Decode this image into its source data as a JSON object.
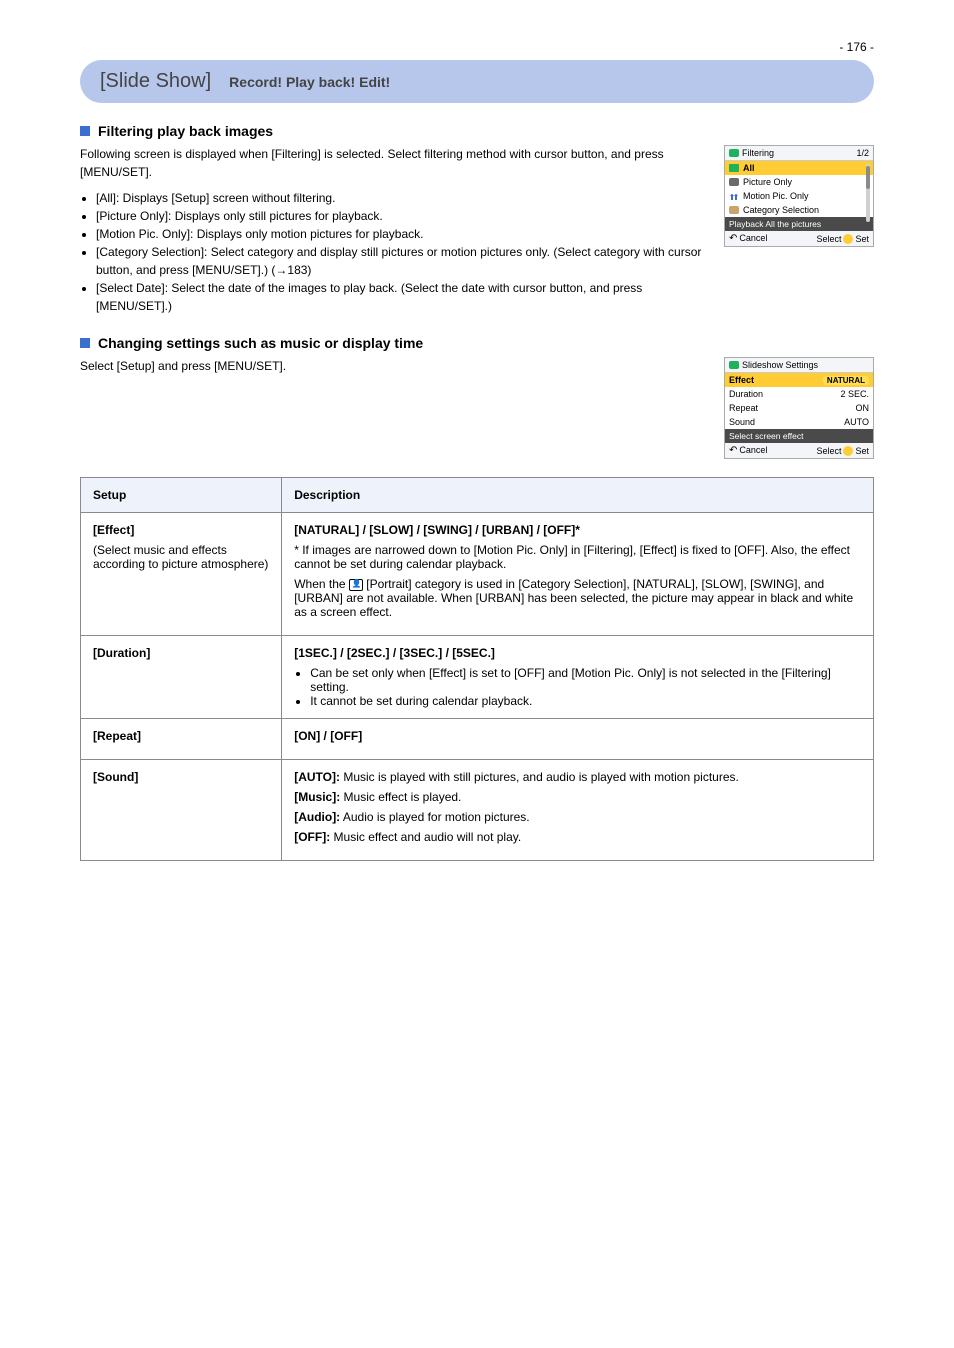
{
  "page_number": "- 176 -",
  "header": {
    "title": "[Slide Show]",
    "slogan": "Record! Play back! Edit!"
  },
  "filtering": {
    "subhead": "Filtering play back images",
    "intro": "Following screen is displayed when [Filtering] is selected. Select filtering method with cursor button, and press [MENU/SET].",
    "bullets": [
      "[All]: Displays [Setup] screen without filtering.",
      "[Picture Only]: Displays only still pictures for playback.",
      "[Motion Pic. Only]: Displays only motion pictures for playback.",
      "[Category Selection]: Select category and display still pictures or motion pictures only. (Select category with cursor button, and press [MENU/SET].) (→183)",
      "[Select Date]: Select the date of the images to play back. (Select the date with cursor button, and press [MENU/SET].)"
    ],
    "screenshot": {
      "title": "Filtering",
      "page": "1/2",
      "items": [
        {
          "label": "All",
          "icon": "green",
          "selected": true
        },
        {
          "label": "Picture Only",
          "icon": "gray"
        },
        {
          "label": "Motion Pic. Only",
          "icon": "blueppl"
        },
        {
          "label": "Category Selection",
          "icon": "tag"
        }
      ],
      "strip": "Playback All the pictures",
      "cancel": "Cancel",
      "select": "Select",
      "set": "Set"
    }
  },
  "settings": {
    "subhead": "Changing settings such as music or display time",
    "intro": "Select [Setup] and press [MENU/SET].",
    "screenshot": {
      "title": "Slideshow Settings",
      "rows": [
        {
          "label": "Effect",
          "value": "NATURAL",
          "selected": true
        },
        {
          "label": "Duration",
          "value": "2 SEC."
        },
        {
          "label": "Repeat",
          "value": "ON"
        },
        {
          "label": "Sound",
          "value": "AUTO"
        }
      ],
      "strip": "Select screen effect",
      "cancel": "Cancel",
      "select": "Select",
      "set": "Set"
    }
  },
  "table": {
    "head": {
      "c1": "Setup",
      "c2": "Description"
    },
    "rows": [
      {
        "name": "[Effect]",
        "name_note": "(Select music and effects according to picture atmosphere)",
        "desc_lead": "[NATURAL] / [SLOW] / [SWING] / [URBAN] / [OFF]*",
        "desc_para1": "* If images are narrowed down to [Motion Pic. Only] in [Filtering], [Effect] is fixed to [OFF]. Also, the effect cannot be set during calendar playback.",
        "desc_para2_pre": "When the ",
        "desc_para2_post": " [Portrait] category is used in [Category Selection], [NATURAL], [SLOW], [SWING], and [URBAN] are not available. When [URBAN] has been selected, the picture may appear in black and white as a screen effect."
      },
      {
        "name": "[Duration]",
        "desc_lead": "[1SEC.] / [2SEC.] / [3SEC.] / [5SEC.]",
        "bullets": [
          "Can be set only when [Effect] is set to [OFF] and [Motion Pic. Only] is not selected in the [Filtering] setting.",
          "It cannot be set during calendar playback."
        ]
      },
      {
        "name": "[Repeat]",
        "desc_lead": "[ON] / [OFF]"
      },
      {
        "name": "[Sound]",
        "desc_lead": "",
        "lines": [
          {
            "opt": "[AUTO]:",
            "text": "Music is played with still pictures, and audio is played with motion pictures."
          },
          {
            "opt": "[Music]:",
            "text": "Music effect is played."
          },
          {
            "opt": "[Audio]:",
            "text": "Audio is played for motion pictures."
          },
          {
            "opt": "[OFF]:",
            "text": "Music effect and audio will not play."
          }
        ]
      }
    ]
  }
}
